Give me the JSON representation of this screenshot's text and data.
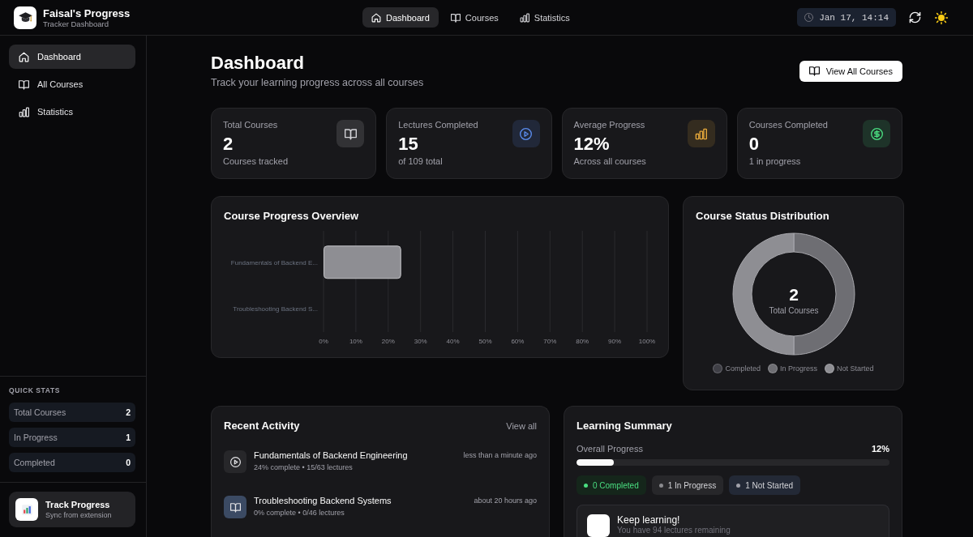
{
  "header": {
    "brand": {
      "title": "Faisal's Progress",
      "subtitle": "Tracker Dashboard"
    },
    "nav": [
      {
        "label": "Dashboard",
        "selected": true
      },
      {
        "label": "Courses",
        "selected": false
      },
      {
        "label": "Statistics",
        "selected": false
      }
    ],
    "datetime": "Jan 17, 14:14"
  },
  "sidebar": {
    "items": [
      {
        "label": "Dashboard",
        "selected": true
      },
      {
        "label": "All Courses",
        "selected": false
      },
      {
        "label": "Statistics",
        "selected": false
      }
    ],
    "quick_stats": {
      "title": "QUICK STATS",
      "rows": [
        {
          "label": "Total Courses",
          "value": "2"
        },
        {
          "label": "In Progress",
          "value": "1"
        },
        {
          "label": "Completed",
          "value": "0"
        }
      ]
    },
    "promo": {
      "title": "Track Progress",
      "subtitle": "Sync from extension"
    }
  },
  "page": {
    "title": "Dashboard",
    "subtitle": "Track your learning progress across all courses",
    "action": "View All Courses"
  },
  "stats": [
    {
      "label": "Total Courses",
      "value": "2",
      "note": "Courses tracked",
      "color": "#d4d4d8"
    },
    {
      "label": "Lectures Completed",
      "value": "15",
      "note": "of 109 total",
      "color": "#5b8def"
    },
    {
      "label": "Average Progress",
      "value": "12%",
      "note": "Across all courses",
      "color": "#e5a83b"
    },
    {
      "label": "Courses Completed",
      "value": "0",
      "note": "1 in progress",
      "color": "#4ade80"
    }
  ],
  "progress_overview": {
    "title": "Course Progress Overview",
    "chart_data": {
      "type": "bar",
      "orientation": "horizontal",
      "grid": true,
      "categories": [
        "Fundamentals of Backend E...",
        "Troubleshooting Backend S..."
      ],
      "values": [
        24,
        0
      ],
      "xlim": [
        0,
        100
      ],
      "xticks": [
        {
          "value": 0,
          "label": "0%"
        },
        {
          "value": 10,
          "label": "10%"
        },
        {
          "value": 20,
          "label": "20%"
        },
        {
          "value": 30,
          "label": "30%"
        },
        {
          "value": 40,
          "label": "40%"
        },
        {
          "value": 50,
          "label": "50%"
        },
        {
          "value": 60,
          "label": "60%"
        },
        {
          "value": 70,
          "label": "70%"
        },
        {
          "value": 80,
          "label": "80%"
        },
        {
          "value": 90,
          "label": "90%"
        },
        {
          "value": 100,
          "label": "100%"
        }
      ]
    }
  },
  "status_distribution": {
    "title": "Course Status Distribution",
    "center_value": "2",
    "center_label": "Total Courses",
    "chart_data": {
      "type": "donut",
      "categories": [
        "Completed",
        "In Progress",
        "Not Started"
      ],
      "values": [
        0,
        50,
        50
      ],
      "colors": [
        "#3f3f46",
        "#6e6e73",
        "#8e8e93"
      ]
    }
  },
  "recent_activity": {
    "title": "Recent Activity",
    "link": "View all",
    "items": [
      {
        "title": "Fundamentals of Backend Engineering",
        "detail": "24% complete • 15/63 lectures",
        "time": "less than a minute ago",
        "kind": "active"
      },
      {
        "title": "Troubleshooting Backend Systems",
        "detail": "0% complete • 0/46 lectures",
        "time": "about 20 hours ago",
        "kind": "pending"
      }
    ]
  },
  "learning_summary": {
    "title": "Learning Summary",
    "progress": {
      "label": "Overall Progress",
      "reading": "12%",
      "level": 0.12
    },
    "badges": [
      {
        "label": "0 Completed",
        "kind": "success",
        "color": "#4ade80"
      },
      {
        "label": "1 In Progress",
        "kind": "neutral",
        "color": "#8a8a8e"
      },
      {
        "label": "1 Not Started",
        "kind": "info",
        "color": "#a1a1aa"
      }
    ],
    "message": {
      "title": "Keep learning!",
      "text": "You have 94 lectures remaining"
    }
  }
}
